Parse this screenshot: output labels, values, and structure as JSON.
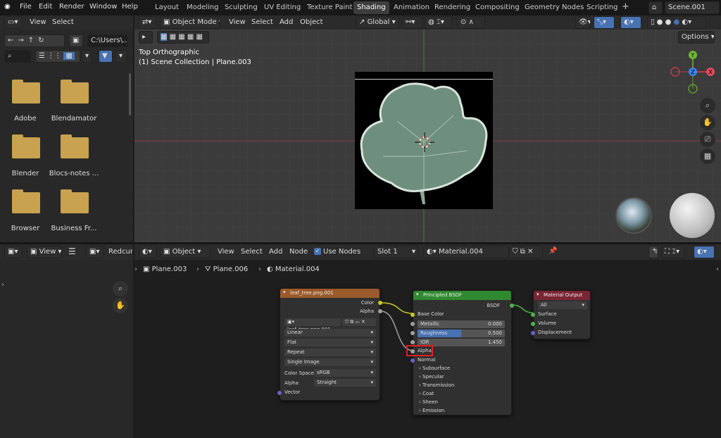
{
  "menu": {
    "file": "File",
    "edit": "Edit",
    "render": "Render",
    "window": "Window",
    "help": "Help"
  },
  "workspaces": [
    "Layout",
    "Modeling",
    "Sculpting",
    "UV Editing",
    "Texture Paint",
    "Shading",
    "Animation",
    "Rendering",
    "Compositing",
    "Geometry Nodes",
    "Scripting"
  ],
  "scene": "Scene.001",
  "filebrowser": {
    "view": "View",
    "select": "Select",
    "path": "C:\\Users\\...",
    "folders": [
      "Adobe",
      "Blendamator",
      "Blender",
      "Blocs-notes ...",
      "Browser",
      "Business Fr..."
    ]
  },
  "viewport": {
    "mode": "Object Mode",
    "view": "View",
    "select": "Select",
    "add": "Add",
    "object": "Object",
    "orientation": "Global",
    "options": "Options",
    "info_line1": "Top Orthographic",
    "info_line2": "(1) Scene Collection | Plane.003",
    "gizmo": {
      "y": "Y",
      "z": "Z",
      "x": "X"
    }
  },
  "lower_left": {
    "view": "View",
    "editor": "Redcurr"
  },
  "node_editor": {
    "mode": "Object",
    "view": "View",
    "select": "Select",
    "add": "Add",
    "node": "Node",
    "use_nodes": "Use Nodes",
    "slot": "Slot 1",
    "material": "Material.004",
    "breadcrumb": [
      "Plane.003",
      "Plane.006",
      "Material.004"
    ]
  },
  "image_node": {
    "title": "leaf_tree.png.001",
    "out_color": "Color",
    "out_alpha": "Alpha",
    "image": "leaf_tree.png.001",
    "interp": "Linear",
    "proj": "Flat",
    "ext": "Repeat",
    "source": "Single Image",
    "cs_label": "Color Space",
    "cs_value": "sRGB",
    "alpha_label": "Alpha",
    "alpha_value": "Straight",
    "vector": "Vector"
  },
  "bsdf_node": {
    "title": "Principled BSDF",
    "out": "BSDF",
    "base_color": "Base Color",
    "metallic_label": "Metallic",
    "metallic": "0.000",
    "roughness_label": "Roughness",
    "roughness": "0.500",
    "ior_label": "IOR",
    "ior": "1.450",
    "alpha": "Alpha",
    "normal": "Normal",
    "panels": [
      "Subsurface",
      "Specular",
      "Transmission",
      "Coat",
      "Sheen",
      "Emission"
    ]
  },
  "output_node": {
    "title": "Material Output",
    "target": "All",
    "surface": "Surface",
    "volume": "Volume",
    "displacement": "Displacement"
  },
  "colors": {
    "accent": "#4772b3",
    "highlight": "#e02020",
    "image_header": "#9a5a2a",
    "shader_header": "#2f8a2f",
    "output_header": "#7a2534"
  }
}
